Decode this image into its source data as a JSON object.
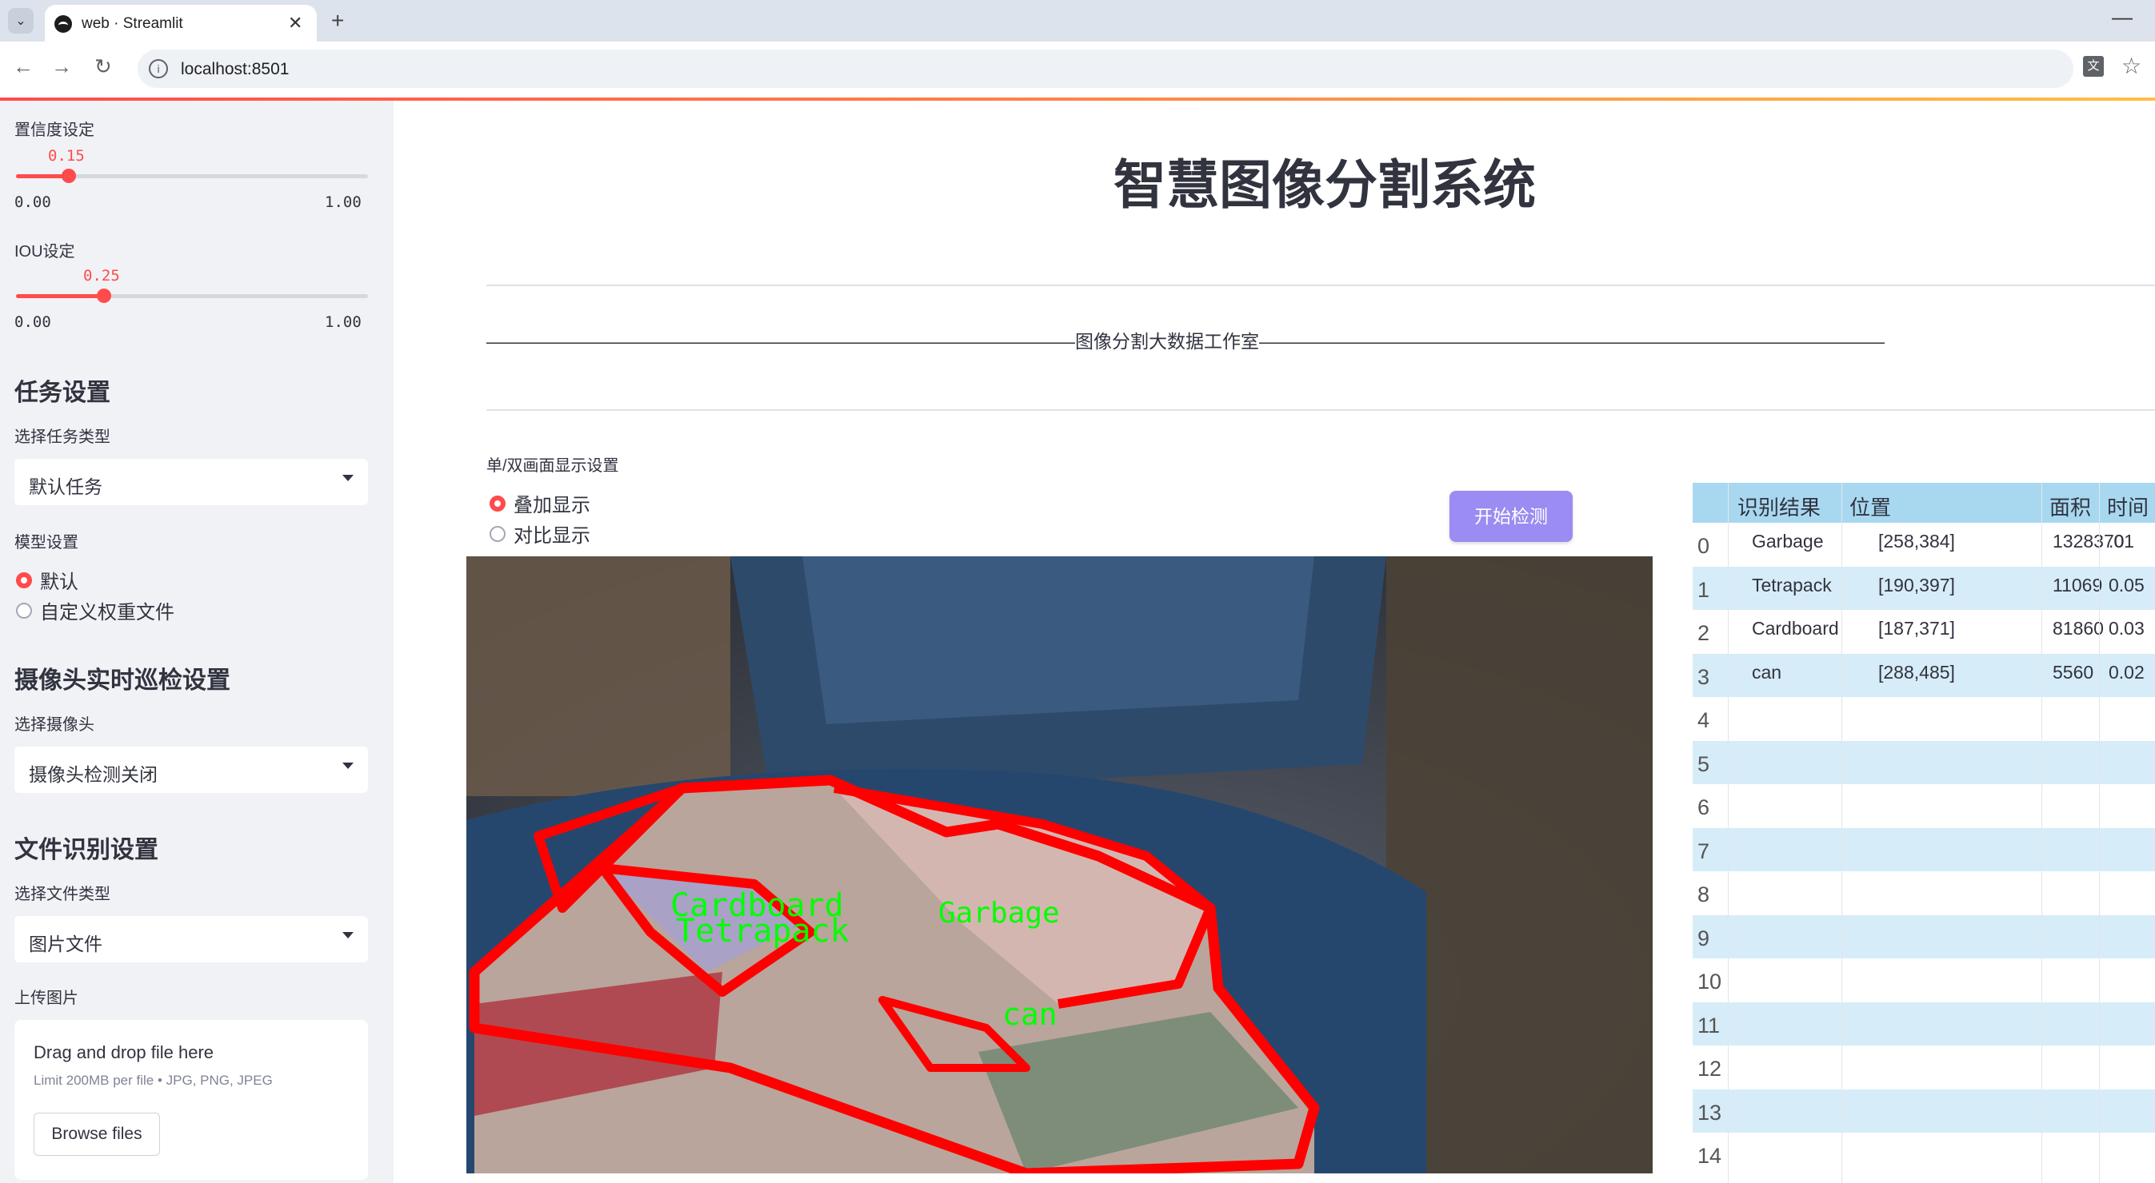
{
  "browser": {
    "tab_title": "web · Streamlit",
    "url": "localhost:8501",
    "new_tab_symbol": "+",
    "close_symbol": "✕",
    "minimize_symbol": "—",
    "back_symbol": "←",
    "forward_symbol": "→",
    "reload_symbol": "↻",
    "bookmark_symbol": "☆",
    "info_symbol": "i",
    "translate_symbol": "文"
  },
  "sidebar": {
    "confidence": {
      "label": "置信度设定",
      "value": "0.15",
      "min": "0.00",
      "max": "1.00",
      "fraction": 0.15
    },
    "iou": {
      "label": "IOU设定",
      "value": "0.25",
      "min": "0.00",
      "max": "1.00",
      "fraction": 0.25
    },
    "task_heading": "任务设置",
    "task_type_label": "选择任务类型",
    "task_type_value": "默认任务",
    "model_label": "模型设置",
    "model_options": [
      {
        "label": "默认",
        "selected": true
      },
      {
        "label": "自定义权重文件",
        "selected": false
      }
    ],
    "camera_heading": "摄像头实时巡检设置",
    "camera_label": "选择摄像头",
    "camera_value": "摄像头检测关闭",
    "file_heading": "文件识别设置",
    "file_type_label": "选择文件类型",
    "file_type_value": "图片文件",
    "upload_label": "上传图片",
    "uploader": {
      "title": "Drag and drop file here",
      "limit": "Limit 200MB per file • JPG, PNG, JPEG",
      "button": "Browse files"
    }
  },
  "main": {
    "title": "智慧图像分割系统",
    "subtitle": "————————————————————————————————图像分割大数据工作室——————————————————————————————————",
    "display_label": "单/双画面显示设置",
    "display_options": [
      {
        "label": "叠加显示",
        "selected": true
      },
      {
        "label": "对比显示",
        "selected": false
      }
    ],
    "start_button": "开始检测",
    "detections": [
      {
        "label": "Garbage"
      },
      {
        "label": "Tetrapack"
      },
      {
        "label": "Cardboard"
      },
      {
        "label": "can"
      }
    ]
  },
  "results_table": {
    "headers": [
      "识别结果",
      "位置",
      "面积",
      "时间"
    ],
    "rows": [
      {
        "index": "0",
        "result": "Garbage",
        "position": "[258,384]",
        "area": "1328370",
        "time": ".01"
      },
      {
        "index": "1",
        "result": "Tetrapack",
        "position": "[190,397]",
        "area": "11069",
        "time": "0.05"
      },
      {
        "index": "2",
        "result": "Cardboard",
        "position": "[187,371]",
        "area": "81860",
        "time": "0.03"
      },
      {
        "index": "3",
        "result": "can",
        "position": "[288,485]",
        "area": "5560",
        "time": "0.02"
      },
      {
        "index": "4"
      },
      {
        "index": "5"
      },
      {
        "index": "6"
      },
      {
        "index": "7"
      },
      {
        "index": "8"
      },
      {
        "index": "9"
      },
      {
        "index": "10"
      },
      {
        "index": "11"
      },
      {
        "index": "12"
      },
      {
        "index": "13"
      },
      {
        "index": "14"
      }
    ]
  },
  "colors": {
    "accent": "#ff4b4b",
    "button": "#9a8cf2",
    "table_header": "#a8d8f0",
    "mask_outline": "#ff0000",
    "mask_label": "#00ff00"
  }
}
